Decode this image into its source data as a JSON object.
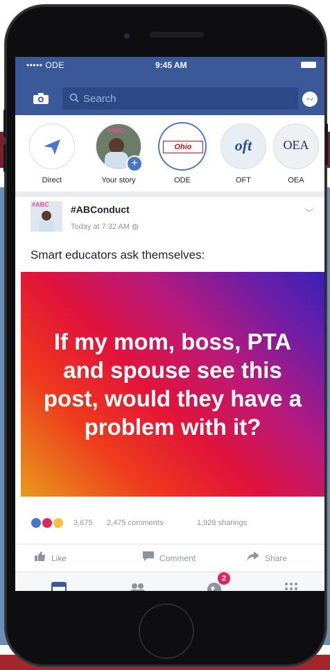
{
  "status_bar": {
    "carrier": "••••• ODE",
    "time": "9:45 AM"
  },
  "header": {
    "search_placeholder": "Search"
  },
  "stories": [
    {
      "label": "Direct"
    },
    {
      "label": "Your story",
      "thumb_text": "#ABC"
    },
    {
      "label": "ODE",
      "logo_text": "Ohio"
    },
    {
      "label": "OFT",
      "logo_text": "oft"
    },
    {
      "label": "OEA",
      "logo_text": "OEA"
    }
  ],
  "post": {
    "avatar_text": "#ABC",
    "author": "#ABConduct",
    "time": "Today at 7:32 AM",
    "text": "Smart educators ask themselves:",
    "banner_text": "If my mom, boss, PTA and spouse see this post, would they have a problem with it?",
    "reaction_count": "3,675",
    "comments": "2,475 comments",
    "shares": "1,928 sharings",
    "actions": {
      "like": "Like",
      "comment": "Comment",
      "share": "Share"
    }
  },
  "tabbar": {
    "notification_badge": "2"
  },
  "colors": {
    "facebook_blue": "#3b5998",
    "banner_start": "#e79a1b",
    "banner_end": "#3a1fb7",
    "badge": "#e0245e"
  }
}
